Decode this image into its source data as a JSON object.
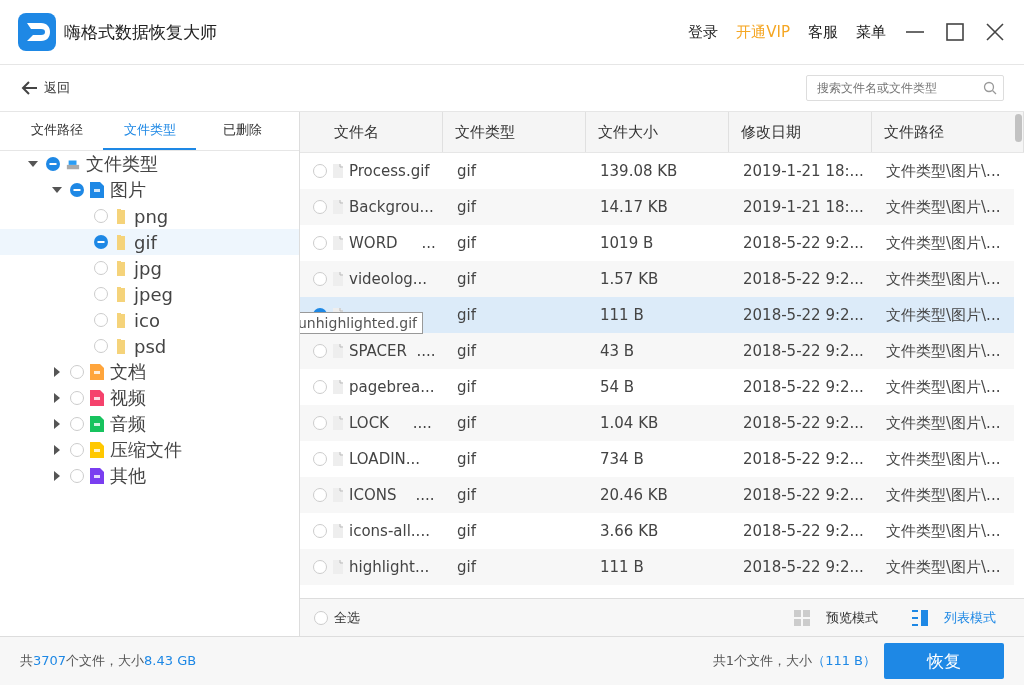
{
  "window": {
    "title": "嗨格式数据恢复大师",
    "actions": [
      {
        "label": "登录",
        "kind": "plain"
      },
      {
        "label": "开通VIP",
        "kind": "vip"
      },
      {
        "label": "客服",
        "kind": "plain"
      },
      {
        "label": "菜单",
        "kind": "plain"
      }
    ]
  },
  "toolbar": {
    "back": "返回",
    "search": {
      "placeholder": "搜索文件名或文件类型"
    }
  },
  "sidebar": {
    "tabs": [
      {
        "label": "文件路径",
        "selected": false
      },
      {
        "label": "文件类型",
        "selected": true
      },
      {
        "label": "已删除",
        "selected": false
      }
    ],
    "tree": [
      {
        "label": "文件类型",
        "kind": "drive",
        "checked": true,
        "expanded": true,
        "selected": false,
        "children": [
          {
            "label": "图片",
            "kind": "image",
            "checked": true,
            "expanded": true,
            "selected": false,
            "children": [
              {
                "label": "png",
                "kind": "folder",
                "checked": false,
                "selected": false
              },
              {
                "label": "gif",
                "kind": "folder",
                "checked": true,
                "selected": true
              },
              {
                "label": "jpg",
                "kind": "folder",
                "checked": false,
                "selected": false
              },
              {
                "label": "jpeg",
                "kind": "folder",
                "checked": false,
                "selected": false
              },
              {
                "label": "ico",
                "kind": "folder",
                "checked": false,
                "selected": false
              },
              {
                "label": "psd",
                "kind": "folder",
                "checked": false,
                "selected": false
              }
            ]
          },
          {
            "label": "文档",
            "kind": "doc",
            "checked": false,
            "expanded": false,
            "selected": false
          },
          {
            "label": "视频",
            "kind": "video",
            "checked": false,
            "expanded": false,
            "selected": false
          },
          {
            "label": "音频",
            "kind": "audio",
            "checked": false,
            "expanded": false,
            "selected": false
          },
          {
            "label": "压缩文件",
            "kind": "zip",
            "checked": false,
            "expanded": false,
            "selected": false
          },
          {
            "label": "其他",
            "kind": "other",
            "checked": false,
            "expanded": false,
            "selected": false
          }
        ]
      }
    ]
  },
  "table": {
    "columns": [
      "文件名",
      "文件类型",
      "文件大小",
      "修改日期",
      "文件路径"
    ],
    "rows": [
      {
        "name": "Process.gif",
        "type": "gif",
        "size": "139.08 KB",
        "date": "2019-1-21 18:...",
        "path": "文件类型\\图片\\...",
        "checked": false,
        "selected": false
      },
      {
        "name": "Backgrou...",
        "type": "gif",
        "size": "14.17 KB",
        "date": "2019-1-21 18:...",
        "path": "文件类型\\图片\\...",
        "checked": false,
        "selected": false
      },
      {
        "name": "WORD     ...",
        "type": "gif",
        "size": "1019 B",
        "date": "2018-5-22 9:2...",
        "path": "文件类型\\图片\\...",
        "checked": false,
        "selected": false
      },
      {
        "name": "videolog...",
        "type": "gif",
        "size": "1.57 KB",
        "date": "2018-5-22 9:2...",
        "path": "文件类型\\图片\\...",
        "checked": false,
        "selected": false
      },
      {
        "tooltip": "unhighlighted.gif",
        "type": "gif",
        "size": "111 B",
        "date": "2018-5-22 9:2...",
        "path": "文件类型\\图片\\...",
        "checked": true,
        "selected": true
      },
      {
        "name": "SPACER  ....",
        "type": "gif",
        "size": "43 B",
        "date": "2018-5-22 9:2...",
        "path": "文件类型\\图片\\...",
        "checked": false,
        "selected": false
      },
      {
        "name": "pagebrea...",
        "type": "gif",
        "size": "54 B",
        "date": "2018-5-22 9:2...",
        "path": "文件类型\\图片\\...",
        "checked": false,
        "selected": false
      },
      {
        "name": "LOCK     ....",
        "type": "gif",
        "size": "1.04 KB",
        "date": "2018-5-22 9:2...",
        "path": "文件类型\\图片\\...",
        "checked": false,
        "selected": false
      },
      {
        "name": "LOADIN...",
        "type": "gif",
        "size": "734 B",
        "date": "2018-5-22 9:2...",
        "path": "文件类型\\图片\\...",
        "checked": false,
        "selected": false
      },
      {
        "name": "ICONS    ....",
        "type": "gif",
        "size": "20.46 KB",
        "date": "2018-5-22 9:2...",
        "path": "文件类型\\图片\\...",
        "checked": false,
        "selected": false
      },
      {
        "name": "icons-all....",
        "type": "gif",
        "size": "3.66 KB",
        "date": "2018-5-22 9:2...",
        "path": "文件类型\\图片\\...",
        "checked": false,
        "selected": false
      },
      {
        "name": "highlight...",
        "type": "gif",
        "size": "111 B",
        "date": "2018-5-22 9:2...",
        "path": "文件类型\\图片\\...",
        "checked": false,
        "selected": false
      }
    ]
  },
  "list_footer": {
    "select_all": {
      "label": "全选",
      "checked": false
    },
    "modes": [
      {
        "label": "预览模式",
        "kind": "grid",
        "selected": false
      },
      {
        "label": "列表模式",
        "kind": "list",
        "selected": true
      }
    ]
  },
  "status_bar": {
    "total": {
      "prefix": "共",
      "count": "3707",
      "middle": "个文件，大小",
      "size": "8.43 GB"
    },
    "selection": {
      "prefix": "共1个文件，大小",
      "size": "（111 B）"
    },
    "recover": "恢复"
  }
}
